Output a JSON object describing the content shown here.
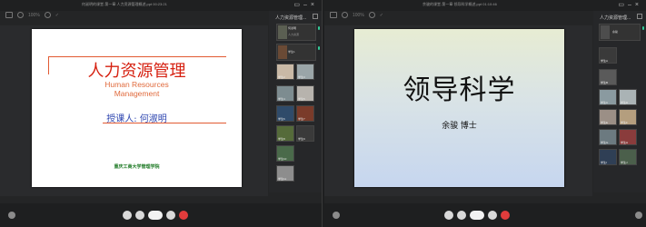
{
  "left_window": {
    "title": "何淑明的课堂-第一章 人力资源管理概述.ppt 00:23:21",
    "zoom": "100%",
    "slide": {
      "title": "人力资源管理",
      "english_line1": "Human Resources",
      "english_line2": "Management",
      "speaker": "授课人: 何淑明",
      "school": "重庆工商大学管理学院"
    },
    "side_title": "人力资源管理...",
    "participants": [
      {
        "label": "何淑明",
        "sub": "人力资源"
      },
      {
        "label": "学生1",
        "sub": ""
      },
      {
        "label": "学生2",
        "sub": ""
      },
      {
        "label": "学生3",
        "sub": ""
      },
      {
        "label": "学生4",
        "sub": ""
      },
      {
        "label": "学生5",
        "sub": ""
      },
      {
        "label": "学生6",
        "sub": ""
      },
      {
        "label": "学生7",
        "sub": ""
      },
      {
        "label": "学生8",
        "sub": ""
      },
      {
        "label": "学生9",
        "sub": ""
      },
      {
        "label": "学生10",
        "sub": ""
      },
      {
        "label": "学生11",
        "sub": ""
      }
    ]
  },
  "right_window": {
    "title": "余骏的课堂-第一章 领导科学概述.ppt 01:10:46",
    "zoom": "100%",
    "slide": {
      "title": "领导科学",
      "speaker": "余骏  博士"
    },
    "side_title": "人力资源管理...",
    "participants": [
      {
        "label": "余骏"
      },
      {
        "label": "学生A"
      },
      {
        "label": "学生B"
      },
      {
        "label": "学生C"
      },
      {
        "label": "学生D"
      },
      {
        "label": "学生E"
      },
      {
        "label": "学生F"
      },
      {
        "label": "学生G"
      },
      {
        "label": "学生H"
      },
      {
        "label": "学生I"
      },
      {
        "label": "学生J"
      }
    ]
  },
  "colors": {
    "hr_title": "#d62010",
    "hr_english": "#e06a3c",
    "hr_speaker": "#2e46b0",
    "hr_school": "#1e7a25",
    "end_button": "#e23c3c"
  }
}
